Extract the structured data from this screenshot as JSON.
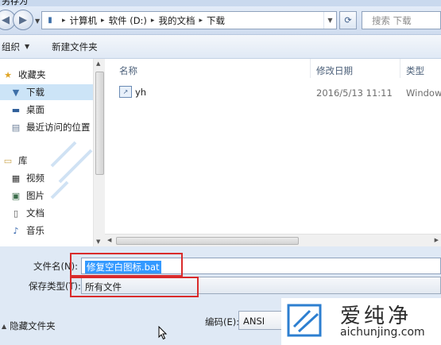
{
  "window": {
    "title_fragment": "另存为"
  },
  "address_bar": {
    "breadcrumbs": [
      "计算机",
      "软件 (D:)",
      "我的文档",
      "下载"
    ],
    "search_placeholder": "搜索 下载"
  },
  "toolbar": {
    "organize_label": "组织",
    "new_folder_label": "新建文件夹"
  },
  "sidebar": {
    "favorites_label": "收藏夹",
    "favorites": [
      {
        "label": "下载",
        "icon": "download-folder-icon"
      },
      {
        "label": "桌面",
        "icon": "desktop-icon"
      },
      {
        "label": "最近访问的位置",
        "icon": "recent-places-icon"
      }
    ],
    "library_label": "库",
    "libraries": [
      {
        "label": "视频",
        "icon": "video-icon"
      },
      {
        "label": "图片",
        "icon": "picture-icon"
      },
      {
        "label": "文档",
        "icon": "document-icon"
      },
      {
        "label": "音乐",
        "icon": "music-icon"
      }
    ]
  },
  "file_list": {
    "columns": [
      "名称",
      "修改日期",
      "类型"
    ],
    "rows": [
      {
        "name": "yh",
        "modified": "2016/5/13 11:11",
        "type": "Window"
      }
    ]
  },
  "form": {
    "filename_label": "文件名(N):",
    "filename_value": "修复空白图标.bat",
    "savetype_label": "保存类型(T):",
    "savetype_value": "所有文件",
    "hide_folders_label": "隐藏文件夹",
    "encoding_label": "编码(E):",
    "encoding_value": "ANSI"
  },
  "watermark": {
    "name_cn": "爱纯净",
    "name_en": "aichunjing.com"
  },
  "colors": {
    "highlight": "#d92b2b",
    "selection": "#3399ff"
  }
}
